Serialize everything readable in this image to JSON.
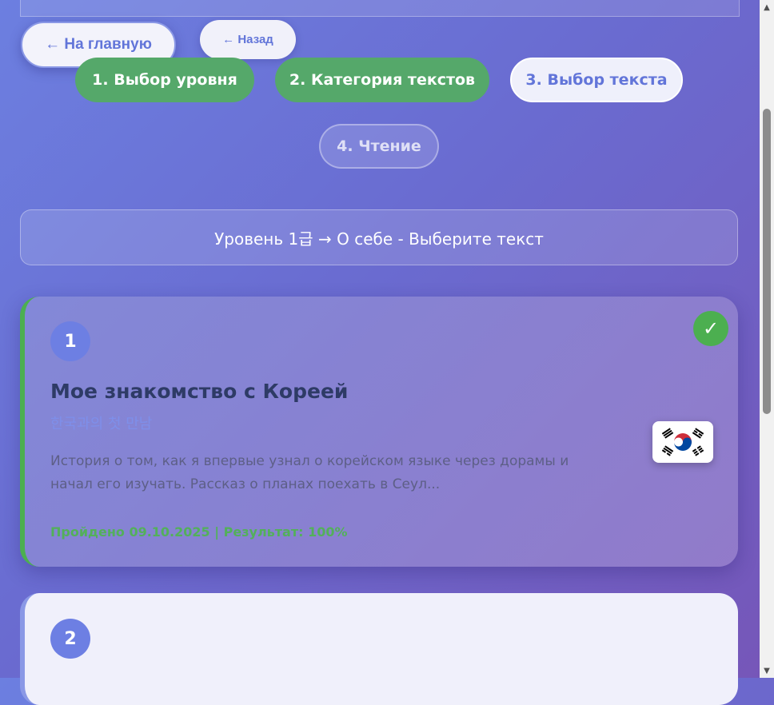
{
  "nav": {
    "home_label": "← На главную",
    "back_label": "← Назад"
  },
  "steps": [
    {
      "label": "1. Выбор уровня",
      "state": "done"
    },
    {
      "label": "2. Категория текстов",
      "state": "done"
    },
    {
      "label": "3. Выбор текста",
      "state": "current"
    },
    {
      "label": "4. Чтение",
      "state": "future"
    }
  ],
  "breadcrumb": "Уровень 1급 → О себе - Выберите текст",
  "texts": [
    {
      "number": "1",
      "title": "Мое знакомство с Кореей",
      "korean_title": "한국과의 첫 만남",
      "description": "История о том, как я впервые узнал о корейском языке через дорамы и начал его изучать. Рассказ о планах поехать в Сеул...",
      "result": "Пройдено 09.10.2025 | Результат: 100%",
      "completed": true,
      "check_icon": "check-icon",
      "flag_icon": "south-korea-flag-icon"
    },
    {
      "number": "2",
      "completed": false
    }
  ],
  "colors": {
    "accent": "#6275d9",
    "done": "#55a86a",
    "completed_check": "#4caf50"
  }
}
